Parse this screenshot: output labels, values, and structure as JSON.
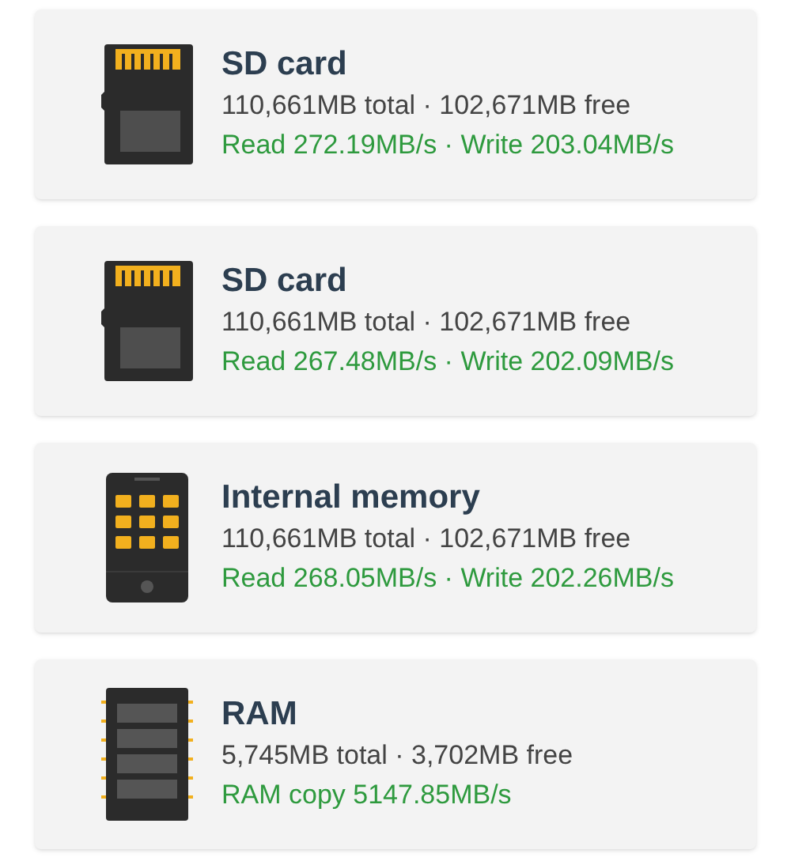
{
  "devices": [
    {
      "kind": "sd",
      "title": "SD card",
      "capacity": "110,661MB total · 102,671MB free",
      "speed": "Read 272.19MB/s · Write 203.04MB/s"
    },
    {
      "kind": "sd",
      "title": "SD card",
      "capacity": "110,661MB total · 102,671MB free",
      "speed": "Read 267.48MB/s · Write 202.09MB/s"
    },
    {
      "kind": "phone",
      "title": "Internal memory",
      "capacity": "110,661MB total · 102,671MB free",
      "speed": "Read 268.05MB/s · Write 202.26MB/s"
    },
    {
      "kind": "ram",
      "title": "RAM",
      "capacity": "5,745MB total · 3,702MB free",
      "speed": "RAM copy 5147.85MB/s"
    }
  ]
}
